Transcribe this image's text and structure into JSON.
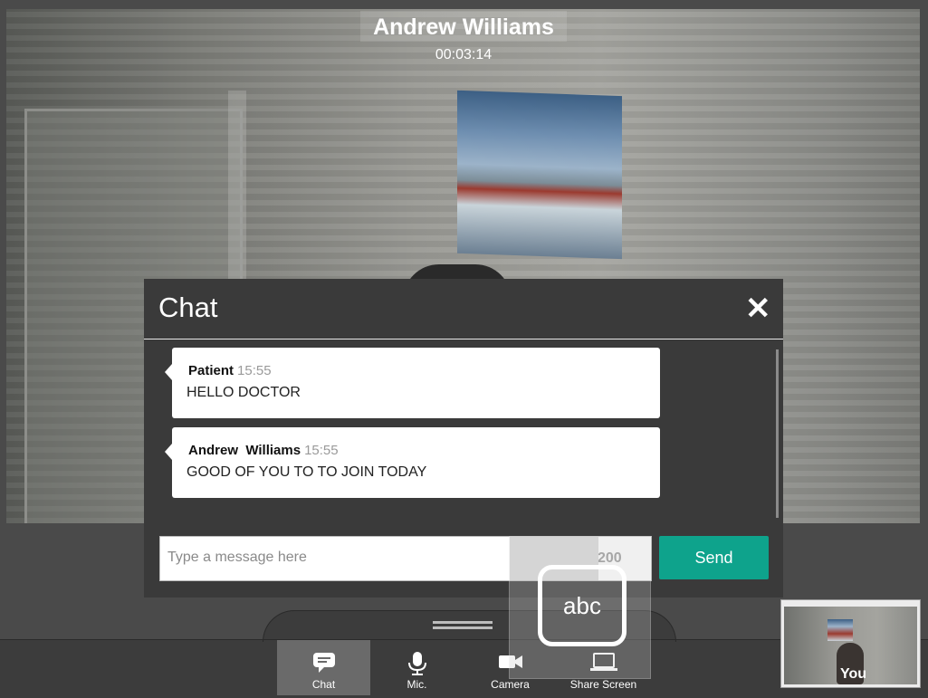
{
  "call": {
    "caller_name": "Andrew Williams",
    "timer": "00:03:14"
  },
  "chat": {
    "title": "Chat",
    "close_icon": "close-icon",
    "messages": [
      {
        "sender": "Patient",
        "time": "15:55",
        "text": "HELLO DOCTOR"
      },
      {
        "sender": "Andrew  Williams",
        "time": "15:55",
        "text": "GOOD OF YOU TO TO JOIN TODAY"
      }
    ],
    "input": {
      "value": "",
      "placeholder": "Type a message here"
    },
    "char_count": "200",
    "send_label": "Send",
    "send_color": "#0ea38c"
  },
  "toolbar": {
    "items": [
      {
        "label": "Chat",
        "icon": "chat-bubble-icon",
        "active": true
      },
      {
        "label": "Mic.",
        "icon": "microphone-icon",
        "active": false
      },
      {
        "label": "Camera",
        "icon": "video-camera-icon",
        "active": false
      },
      {
        "label": "Share Screen",
        "icon": "laptop-icon",
        "active": false
      }
    ]
  },
  "keyboard": {
    "label": "abc",
    "icon": "keyboard-toggle-icon"
  },
  "self_view": {
    "label": "You"
  }
}
